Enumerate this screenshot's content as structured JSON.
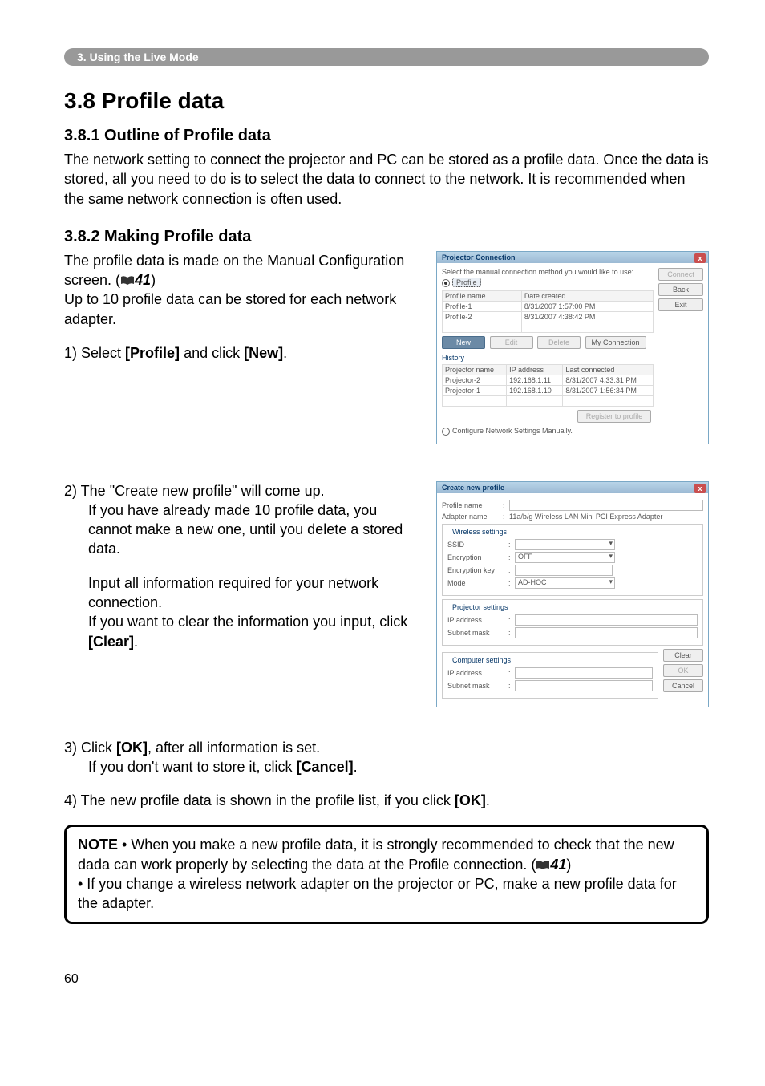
{
  "header": {
    "chapter": "3. Using the Live Mode"
  },
  "h1": "3.8 Profile data",
  "sec1": {
    "title": "3.8.1 Outline of Profile data",
    "body": "The network setting to connect the projector and PC can be stored as a profile data. Once the data is stored, all you need to do is to select the data to connect to the network. It is recommended when the same network connection is often used."
  },
  "sec2": {
    "title": "3.8.2 Making Profile data",
    "p1a": "The profile data is made on the Manual Configuration screen. (",
    "ref1": "41",
    "p1b": ")",
    "p1c": "Up to 10 profile data can be stored for each network adapter.",
    "step1_a": "1) Select ",
    "step1_b": "[Profile]",
    "step1_c": " and click ",
    "step1_d": "[New]",
    "step1_e": ".",
    "step2_a": "2) The \"Create new profile\" will come up.",
    "step2_b": "If you have already made 10 profile data, you cannot make a new one, until you delete a stored data.",
    "step2_c": "Input all information required for your network connection.",
    "step2_d": "If you want to clear the information you input, click ",
    "step2_e": "[Clear]",
    "step2_f": ".",
    "step3_a": "3) Click ",
    "step3_b": "[OK]",
    "step3_c": ", after all information is set.",
    "step3_d": "If you don't want to store it, click ",
    "step3_e": "[Cancel]",
    "step3_f": ".",
    "step4_a": "4) The new profile data is shown in the profile list, if you click ",
    "step4_b": "[OK]",
    "step4_c": "."
  },
  "note": {
    "label": "NOTE",
    "p1": " • When you make a new profile data, it is strongly recommended to check that the new dada can work properly by selecting the data at the Profile connection. (",
    "ref": "41",
    "p1b": ")",
    "p2": "• If you change a wireless network adapter on the projector or PC, make a new profile data for the adapter."
  },
  "dlg1": {
    "title": "Projector Connection",
    "subtitle": "Select the manual connection method you would like to use:",
    "radio_profile": "Profile",
    "cols": {
      "pname": "Profile name",
      "date": "Date created"
    },
    "rows": [
      {
        "name": "Profile-1",
        "date": "8/31/2007 1:57:00 PM"
      },
      {
        "name": "Profile-2",
        "date": "8/31/2007 4:38:42 PM"
      }
    ],
    "btns": {
      "new": "New",
      "edit": "Edit",
      "delete": "Delete",
      "myconn": "My Connection"
    },
    "hist": "History",
    "hcols": {
      "proj": "Projector name",
      "ip": "IP address",
      "last": "Last connected"
    },
    "hrows": [
      {
        "p": "Projector-2",
        "ip": "192.168.1.11",
        "last": "8/31/2007 4:33:31 PM"
      },
      {
        "p": "Projector-1",
        "ip": "192.168.1.10",
        "last": "8/31/2007 1:56:34 PM"
      }
    ],
    "regbtn": "Register to profile",
    "radio_manual": "Configure Network Settings Manually.",
    "side": {
      "connect": "Connect",
      "back": "Back",
      "exit": "Exit"
    }
  },
  "dlg2": {
    "title": "Create new profile",
    "pname": "Profile name",
    "aname_lbl": "Adapter name",
    "aname_val": "11a/b/g Wireless LAN Mini PCI Express Adapter",
    "grp_wireless": "Wireless settings",
    "ssid": "SSID",
    "enc": "Encryption",
    "enc_val": "OFF",
    "enckey": "Encryption key",
    "mode": "Mode",
    "mode_val": "AD-HOC",
    "grp_proj": "Projector settings",
    "grp_comp": "Computer settings",
    "ip": "IP address",
    "subnet": "Subnet mask",
    "btns": {
      "clear": "Clear",
      "ok": "OK",
      "cancel": "Cancel"
    }
  },
  "pagenum": "60"
}
